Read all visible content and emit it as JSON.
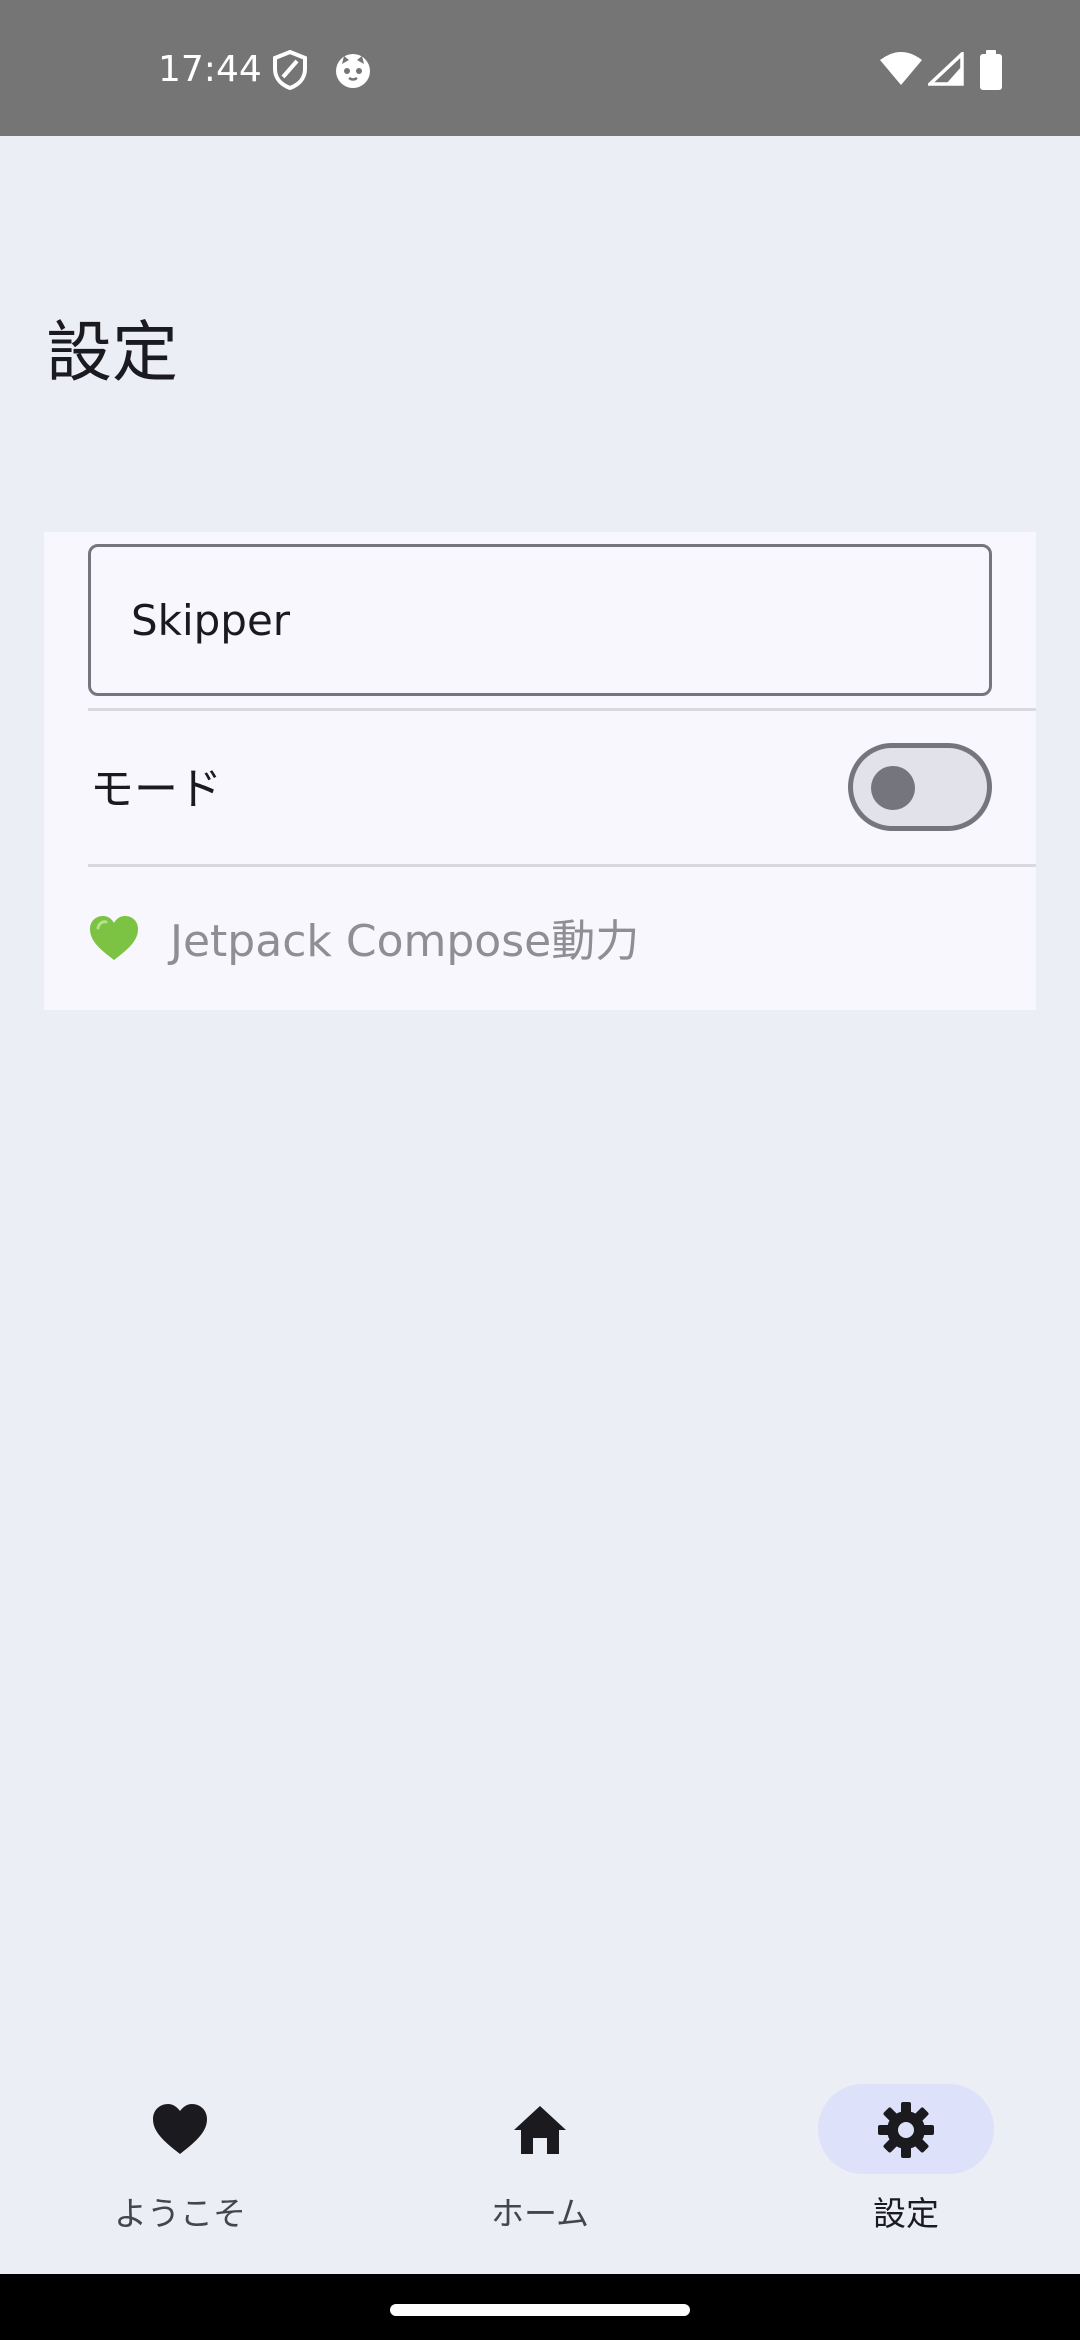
{
  "status_bar": {
    "time": "17:44",
    "icons": [
      "shield-icon",
      "cat-face-icon",
      "wifi-icon",
      "cell-signal-icon",
      "battery-icon"
    ]
  },
  "page": {
    "title": "設定"
  },
  "settings": {
    "name_field_value": "Skipper",
    "mode_label": "モード",
    "mode_enabled": false,
    "powered_by_emoji": "💚",
    "powered_by_text": "Jetpack Compose動力"
  },
  "bottom_nav": {
    "items": [
      {
        "label": "ようこそ",
        "icon": "heart-icon",
        "selected": false
      },
      {
        "label": "ホーム",
        "icon": "home-icon",
        "selected": false
      },
      {
        "label": "設定",
        "icon": "gear-icon",
        "selected": true
      }
    ]
  },
  "colors": {
    "background": "#eceef5",
    "card": "#f7f7fd",
    "status_bar": "#757575",
    "nav_active_pill": "#dde1f9",
    "outline": "#75757e"
  }
}
